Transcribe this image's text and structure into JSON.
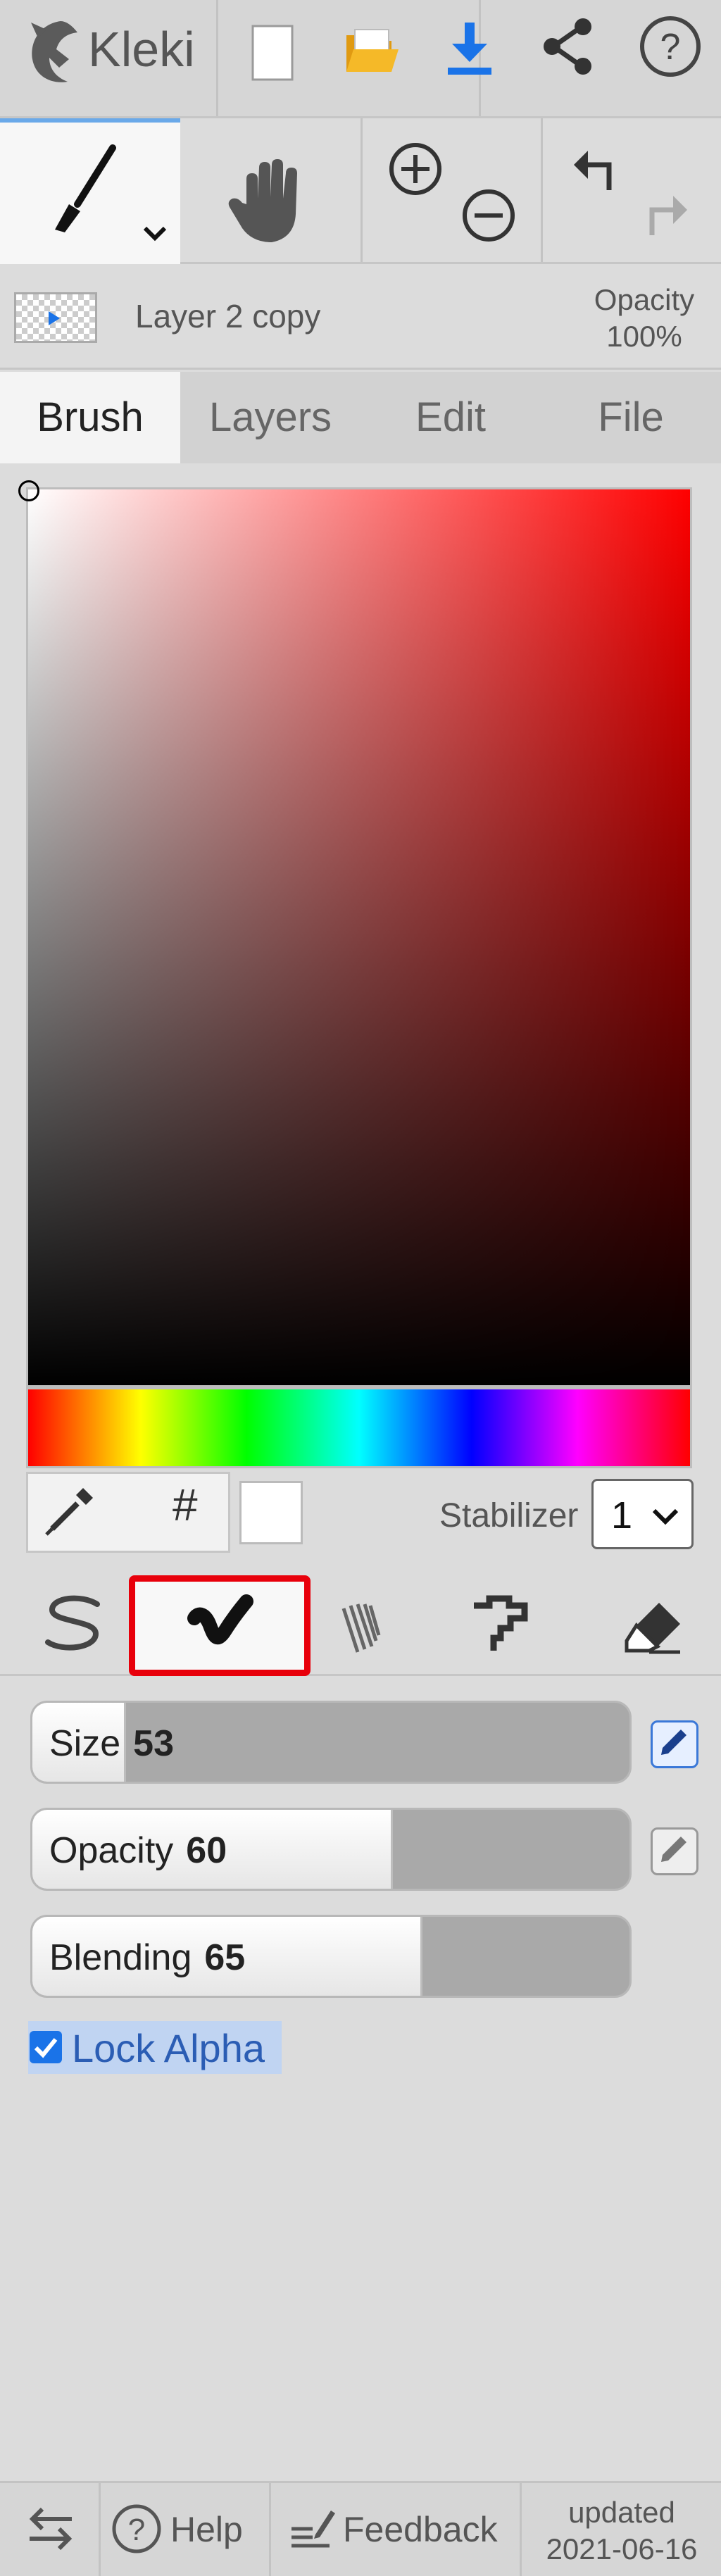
{
  "app": {
    "name": "Kleki"
  },
  "top_toolbar": {
    "icons": [
      "kleki-logo-icon",
      "new-file-icon",
      "open-folder-icon",
      "download-icon",
      "share-icon",
      "help-circle-icon"
    ],
    "colors": {
      "open_folder": "#f2b01e",
      "download": "#1a73e8"
    }
  },
  "tool_row": {
    "tools": [
      "brush-tool-icon",
      "hand-tool-icon",
      "zoom-in-icon",
      "zoom-out-icon",
      "undo-icon",
      "redo-icon"
    ],
    "active_tool": "brush"
  },
  "layer": {
    "name": "Layer 2 copy",
    "opacity_label": "Opacity",
    "opacity_value": "100%"
  },
  "tabs": [
    {
      "label": "Brush",
      "active": true
    },
    {
      "label": "Layers",
      "active": false
    },
    {
      "label": "Edit",
      "active": false
    },
    {
      "label": "File",
      "active": false
    }
  ],
  "color_picker": {
    "hue_color": "#ff0000",
    "selected_color": "#ffffff",
    "hash_label": "#",
    "stabilizer_label": "Stabilizer",
    "stabilizer_value": "1"
  },
  "brush_types": {
    "items": [
      "pen-brush-icon",
      "blend-brush-icon",
      "sketchy-brush-icon",
      "pixel-brush-icon",
      "eraser-icon"
    ],
    "selected": "blend-brush-icon",
    "highlight_color": "#e8000b"
  },
  "sliders": {
    "size": {
      "label": "Size",
      "value": "53",
      "fraction": 0.153
    },
    "opacity": {
      "label": "Opacity",
      "value": "60",
      "fraction": 0.6
    },
    "blending": {
      "label": "Blending",
      "value": "65",
      "fraction": 0.65
    }
  },
  "lock_alpha": {
    "label": "Lock Alpha",
    "checked": true
  },
  "bottom_bar": {
    "help_label": "Help",
    "feedback_label": "Feedback",
    "updated_line1": "updated",
    "updated_line2": "2021-06-16"
  }
}
